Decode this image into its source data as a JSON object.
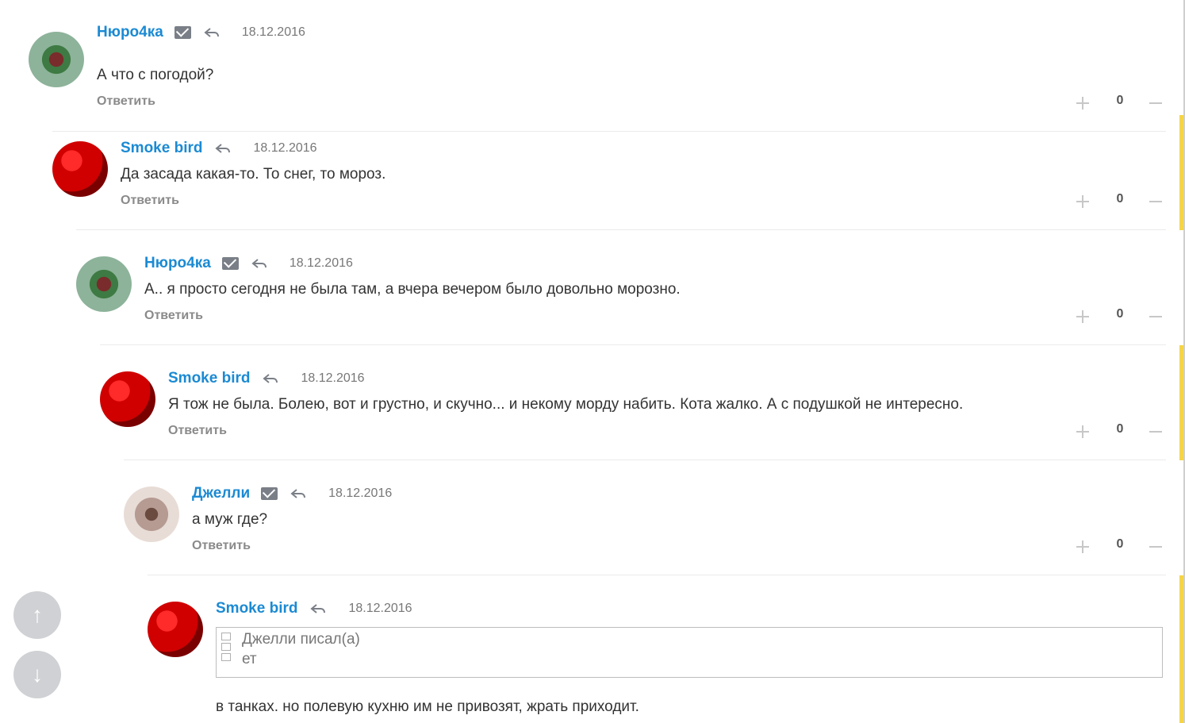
{
  "actions": {
    "answer_label": "Ответить"
  },
  "comments": [
    {
      "author": "Нюро4ка",
      "date": "18.12.2016",
      "text": "А что с погодой?",
      "score": "0",
      "avatar": "strawberry-avatar",
      "has_mail": true
    },
    {
      "author": "Smoke bird",
      "date": "18.12.2016",
      "text": "Да засада какая-то. То снег, то мороз.",
      "score": "0",
      "avatar": "bird-avatar",
      "has_mail": false
    },
    {
      "author": "Нюро4ка",
      "date": "18.12.2016",
      "text": "А.. я просто сегодня не была там, а вчера вечером было довольно морозно.",
      "score": "0",
      "avatar": "strawberry-avatar",
      "has_mail": true
    },
    {
      "author": "Smoke bird",
      "date": "18.12.2016",
      "text": "Я тож не была. Болею, вот и грустно, и скучно... и некому морду набить. Кота жалко. А с подушкой не интересно.",
      "score": "0",
      "avatar": "bird-avatar",
      "has_mail": false
    },
    {
      "author": "Джелли",
      "date": "18.12.2016",
      "text": "а муж где?",
      "score": "0",
      "avatar": "jelly-avatar",
      "has_mail": true
    },
    {
      "author": "Smoke bird",
      "date": "18.12.2016",
      "quote_title": "Джелли писал(а)",
      "quote_text": "ет",
      "text": "в танках. но полевую кухню им не привозят, жрать приходит.",
      "avatar": "bird-avatar",
      "has_mail": false
    }
  ],
  "scroll_controls": {
    "up_icon": "arrow-up-icon",
    "down_icon": "arrow-down-icon"
  },
  "colors": {
    "author": "#1b8ad3",
    "accent": "#f5d44a",
    "muted": "#8a8a8a"
  }
}
